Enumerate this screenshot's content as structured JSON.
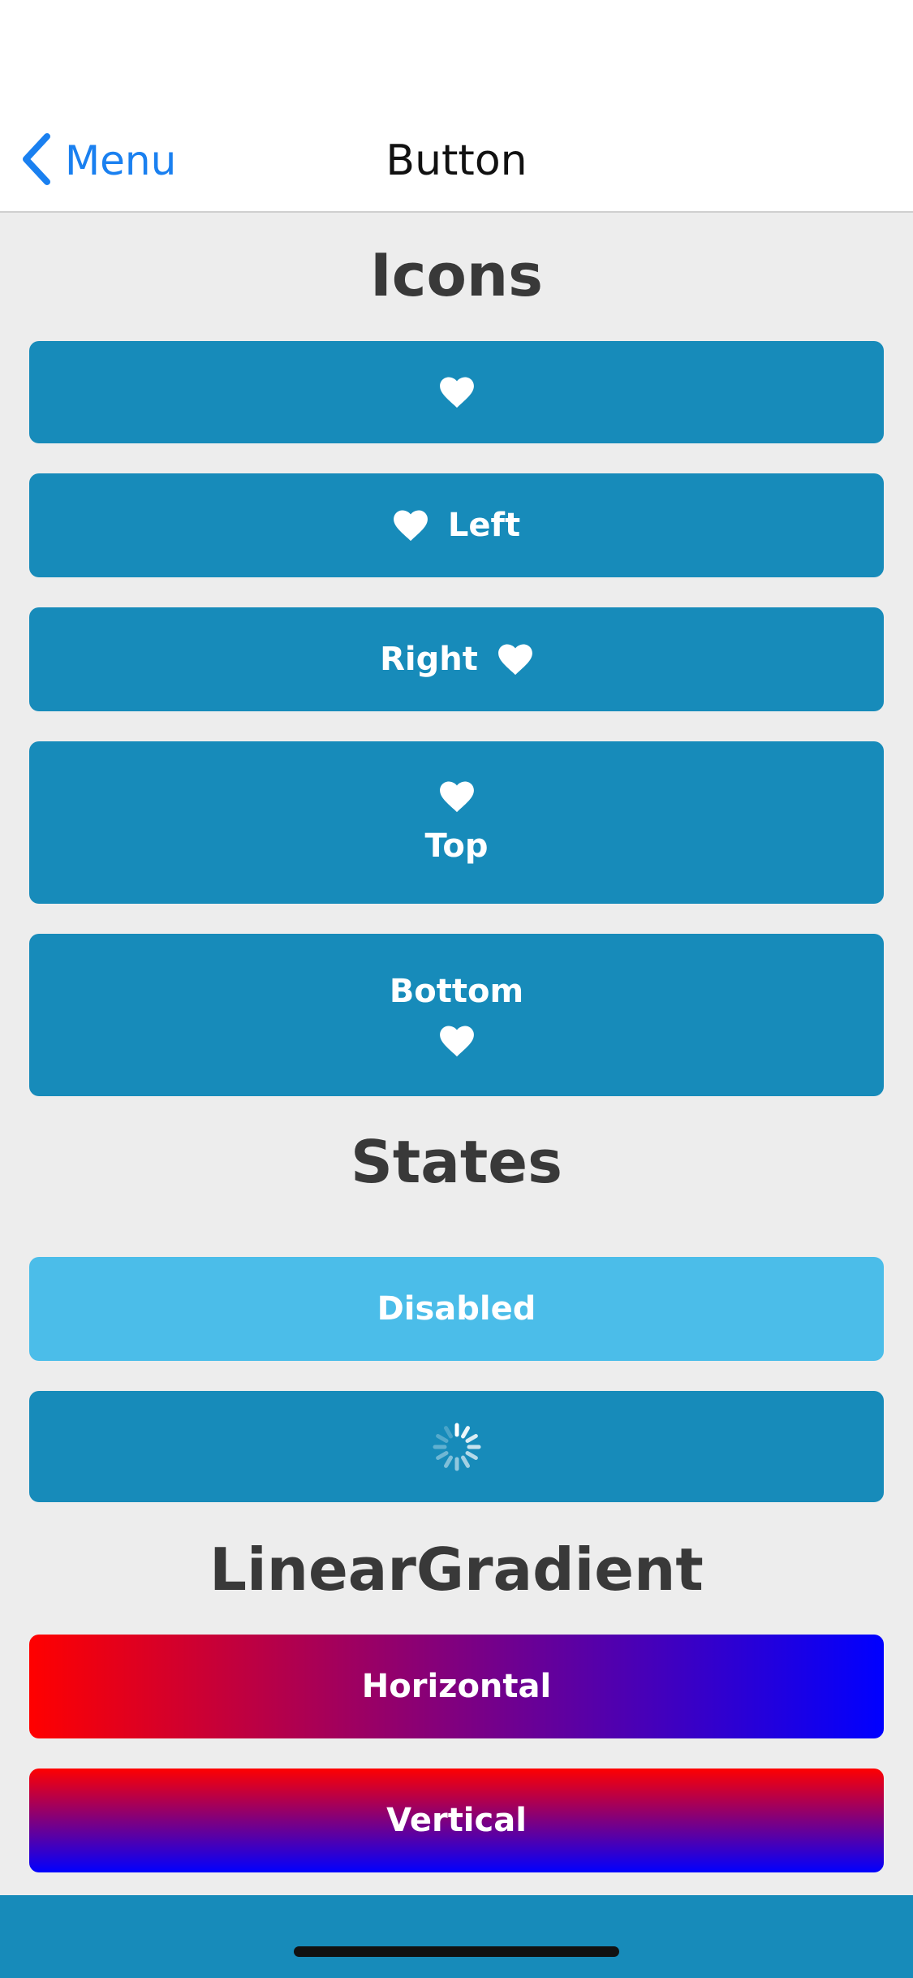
{
  "nav": {
    "back_label": "Menu",
    "title": "Button"
  },
  "sections": {
    "icons_title": "Icons",
    "states_title": "States",
    "gradient_title": "LinearGradient"
  },
  "buttons": {
    "left_label": "Left",
    "right_label": "Right",
    "top_label": "Top",
    "bottom_label": "Bottom",
    "disabled_label": "Disabled",
    "horizontal_label": "Horizontal",
    "vertical_label": "Vertical"
  },
  "icons": {
    "back": "chevron-left-icon",
    "button_icon": "heart-icon",
    "loading": "spinner-icon"
  },
  "colors": {
    "primary": "#178bba",
    "disabled": "#4bbde9",
    "link": "#1a80f0",
    "gradient_start": "#ff0000",
    "gradient_end": "#0000ff"
  }
}
